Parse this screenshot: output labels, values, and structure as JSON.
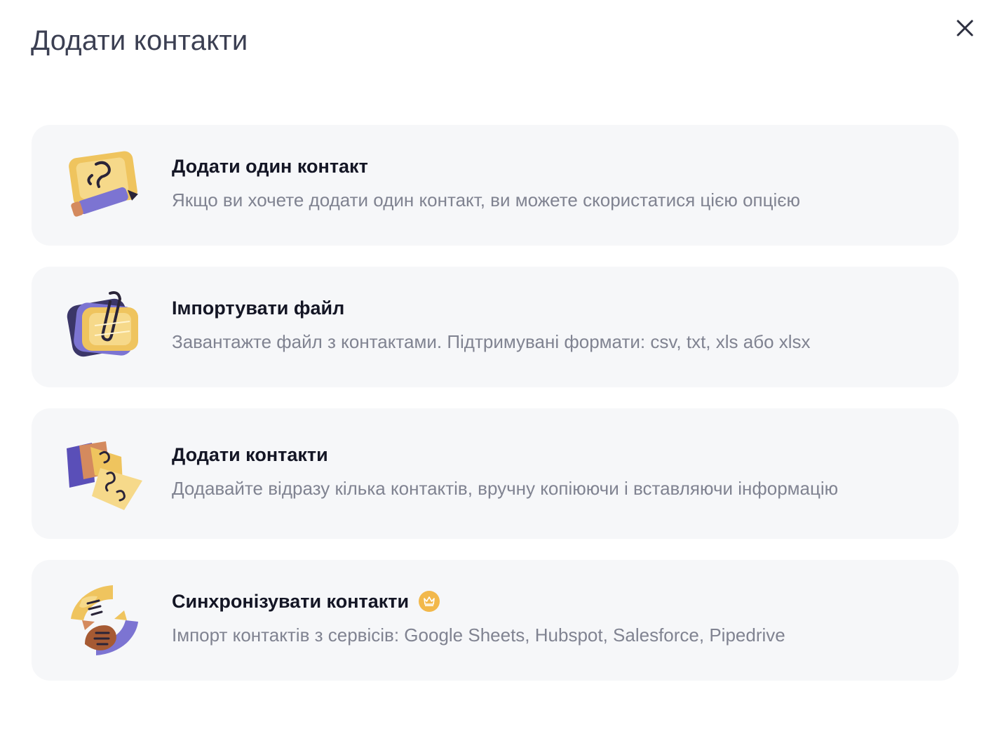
{
  "modal": {
    "title": "Додати контакти",
    "close_icon": "close-icon"
  },
  "options": [
    {
      "icon": "contact-card-pencil-icon",
      "title": "Додати один контакт",
      "description": "Якщо ви хочете додати один контакт, ви можете скористатися цією опцією"
    },
    {
      "icon": "file-paperclip-icon",
      "title": "Імпортувати файл",
      "description": "Завантажте файл з контактами. Підтримувані формати: csv, txt, xls або xlsx"
    },
    {
      "icon": "multiple-contact-cards-icon",
      "title": "Додати контакти",
      "description": "Додавайте відразу кілька контактів, вручну копіюючи і вставляючи інформацію"
    },
    {
      "icon": "sync-hands-icon",
      "title": "Синхронізувати контакти",
      "badge_icon": "crown-icon",
      "description": "Імпорт контактів з сервісів: Google Sheets, Hubspot, Salesforce, Pipedrive"
    }
  ],
  "colors": {
    "card_background": "#f6f7f9",
    "title_text": "#3b3f52",
    "option_title": "#141625",
    "option_description": "#808391",
    "illustration_yellow": "#efc45e",
    "illustration_purple": "#7c74d2",
    "badge": "#f2b84b"
  }
}
